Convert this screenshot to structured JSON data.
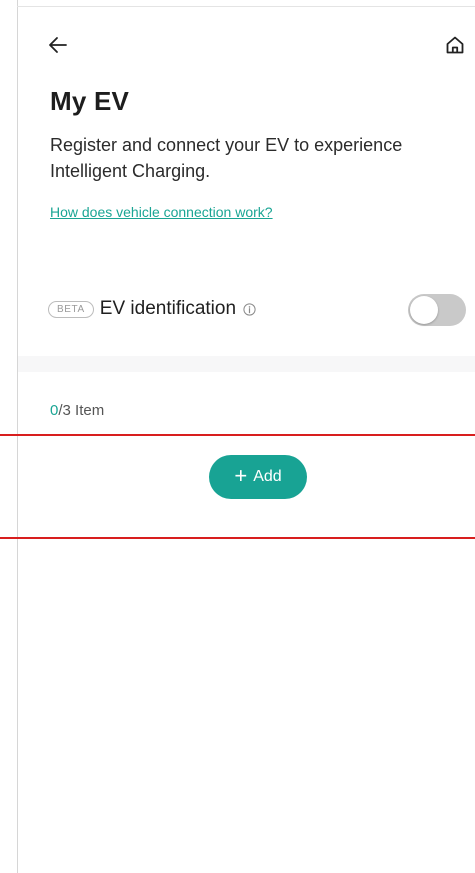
{
  "header": {
    "back_icon": "arrow-left-icon",
    "home_icon": "home-icon"
  },
  "page": {
    "title": "My EV",
    "subtitle": "Register and connect your EV to experience Intelligent Charging.",
    "help_link": "How does vehicle connection work?"
  },
  "ev_identification": {
    "badge": "BETA",
    "label": "EV identification",
    "info_icon": "info-icon",
    "toggle_on": false
  },
  "items": {
    "current": "0",
    "total": "/3 Item"
  },
  "add_button": {
    "plus": "+",
    "label": "Add"
  },
  "colors": {
    "accent": "#18a394",
    "link": "#1aa594",
    "toggle_off": "#c9c9c9",
    "annotation_red": "#d81e1e"
  }
}
